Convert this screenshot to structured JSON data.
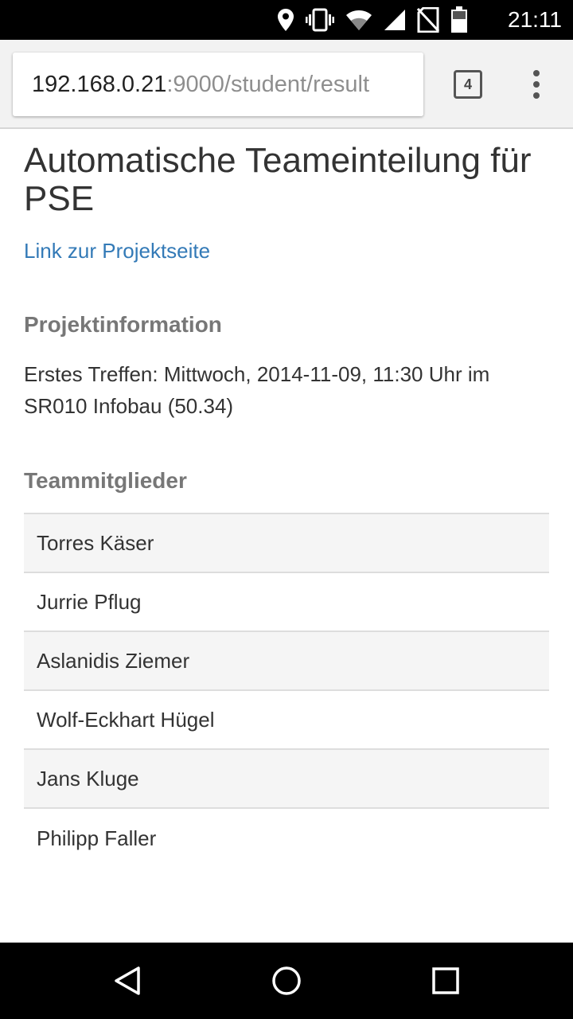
{
  "status_bar": {
    "time": "21:11",
    "icons": [
      "location-icon",
      "vibrate-icon",
      "wifi-icon",
      "signal-icon",
      "no-sim-icon",
      "battery-icon"
    ]
  },
  "browser": {
    "url_host": "192.168.0.21",
    "url_rest": ":9000/student/result",
    "tab_count": "4"
  },
  "page": {
    "title": "Automatische Teameinteilung für PSE",
    "project_link": "Link zur Projektseite",
    "info_heading": "Projektinformation",
    "info_text": "Erstes Treffen: Mittwoch, 2014-11-09, 11:30 Uhr im SR010 Infobau (50.34)",
    "team_heading": "Teammitglieder",
    "members": [
      "Torres Käser",
      "Jurrie Pflug",
      "Aslanidis Ziemer",
      "Wolf-Eckhart Hügel",
      "Jans Kluge",
      "Philipp Faller"
    ]
  },
  "colors": {
    "link": "#337ab7",
    "heading": "#777777",
    "text": "#333333",
    "row_stripe": "#f5f5f5"
  }
}
